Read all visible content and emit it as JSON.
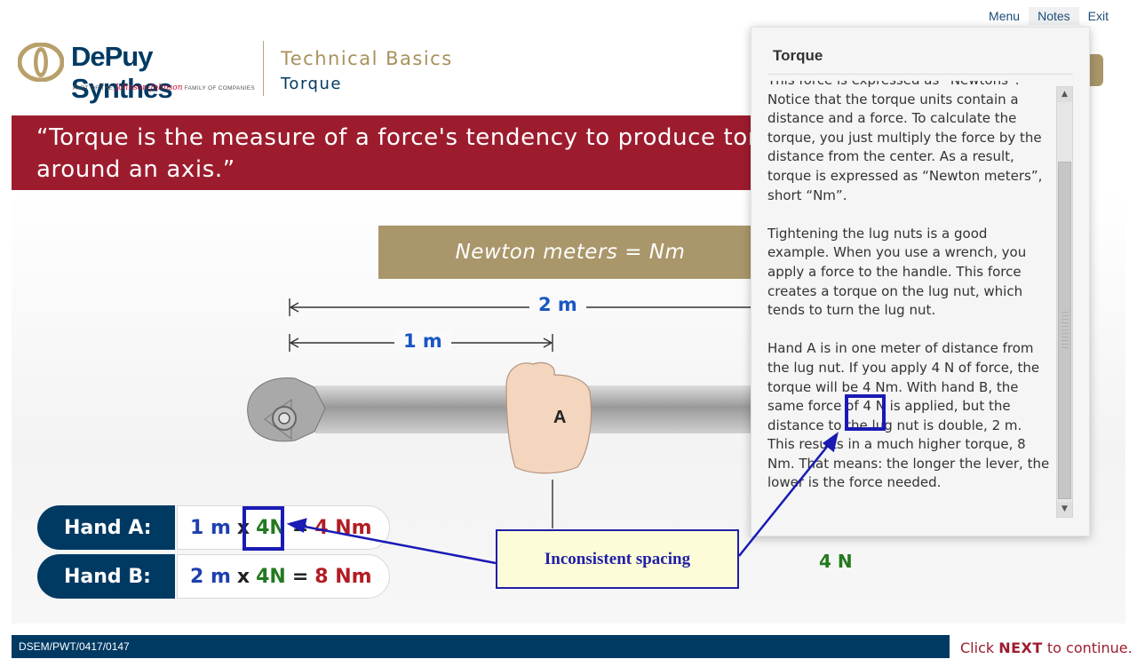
{
  "nav": {
    "menu": "Menu",
    "notes": "Notes",
    "exit": "Exit"
  },
  "brand": {
    "name": "DePuy Synthes",
    "sub_prefix": "PART OF THE",
    "sub_jj": "Johnson-Johnson",
    "sub_suffix": "FAMILY OF COMPANIES"
  },
  "course": {
    "title": "Technical Basics",
    "topic": "Torque"
  },
  "quote": {
    "line1": "“Torque is the measure of a force's tendency to produce torsion",
    "line2": "around an axis.”"
  },
  "unit_box": "Newton meters = Nm",
  "diagram": {
    "dim_2m": "2 m",
    "dim_1m": "1 m",
    "hand_a_label": "A",
    "force_b": "4 N"
  },
  "formulas": {
    "hand_a": {
      "label": "Hand A:",
      "dist": "1 m",
      "times": "x",
      "force": "4N",
      "eq": "=",
      "result": "4 Nm"
    },
    "hand_b": {
      "label": "Hand B:",
      "dist": "2 m",
      "times": "x",
      "force": "4N",
      "eq": "=",
      "result": "8 Nm"
    }
  },
  "notes": {
    "title": "Torque",
    "p0": "This force is expressed as “Newtons”. Notice that the torque units contain a distance and a force. To calculate the torque, you just multiply the force by the distance from the center. As a result, torque is expressed as “Newton meters”, short “Nm”.",
    "p1": "Tightening the lug nuts is a good example. When you use a wrench, you apply a force to the handle. This force creates a torque on the lug nut, which tends to turn the lug nut.",
    "p2": "Hand A is in one meter of distance from the lug nut. If you apply 4 N of force, the torque will be 4 Nm. With hand B, the same force of 4 N is applied, but the distance to the lug nut is double, 2 m. This results in a much higher torque, 8 Nm. That means: the longer the lever, the lower is the force needed.",
    "scroll_up": "▲",
    "scroll_down": "▼"
  },
  "annotation": {
    "label": "Inconsistent spacing"
  },
  "footer": {
    "code": "DSEM/PWT/0417/0147"
  },
  "next": {
    "pre": "Click ",
    "bold": "NEXT",
    "post": " to continue."
  },
  "colors": {
    "brand_navy": "#003a63",
    "quote_red": "#9c1c2e",
    "gold": "#a9966a",
    "annotation_blue": "#1a1ab5"
  }
}
